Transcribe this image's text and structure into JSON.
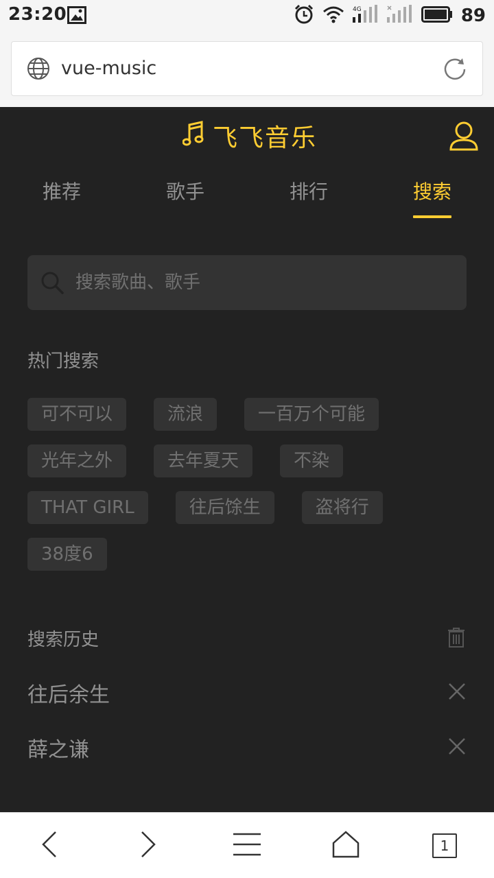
{
  "status_bar": {
    "time": "23:20",
    "network": "4G",
    "battery": "89",
    "icons": [
      "image-icon",
      "alarm-icon",
      "wifi-icon",
      "signal-icon",
      "battery-icon"
    ]
  },
  "browser": {
    "url": "vue-music",
    "tab_count": "1",
    "icons": [
      "globe-icon",
      "reload-icon",
      "back-icon",
      "forward-icon",
      "menu-icon",
      "home-icon"
    ]
  },
  "app": {
    "title": "飞飞音乐",
    "accent_color": "#ffcd32",
    "background_color": "#222222",
    "tabs": [
      {
        "label": "推荐",
        "active": false
      },
      {
        "label": "歌手",
        "active": false
      },
      {
        "label": "排行",
        "active": false
      },
      {
        "label": "搜索",
        "active": true
      }
    ],
    "search": {
      "placeholder": "搜索歌曲、歌手",
      "value": ""
    },
    "hot": {
      "title": "热门搜索",
      "items": [
        "可不可以",
        "流浪",
        "一百万个可能",
        "光年之外",
        "去年夏天",
        "不染",
        "THAT GIRL",
        "往后馀生",
        "盗将行",
        "38度6"
      ]
    },
    "history": {
      "title": "搜索历史",
      "items": [
        "往后余生",
        "薛之谦"
      ]
    }
  }
}
